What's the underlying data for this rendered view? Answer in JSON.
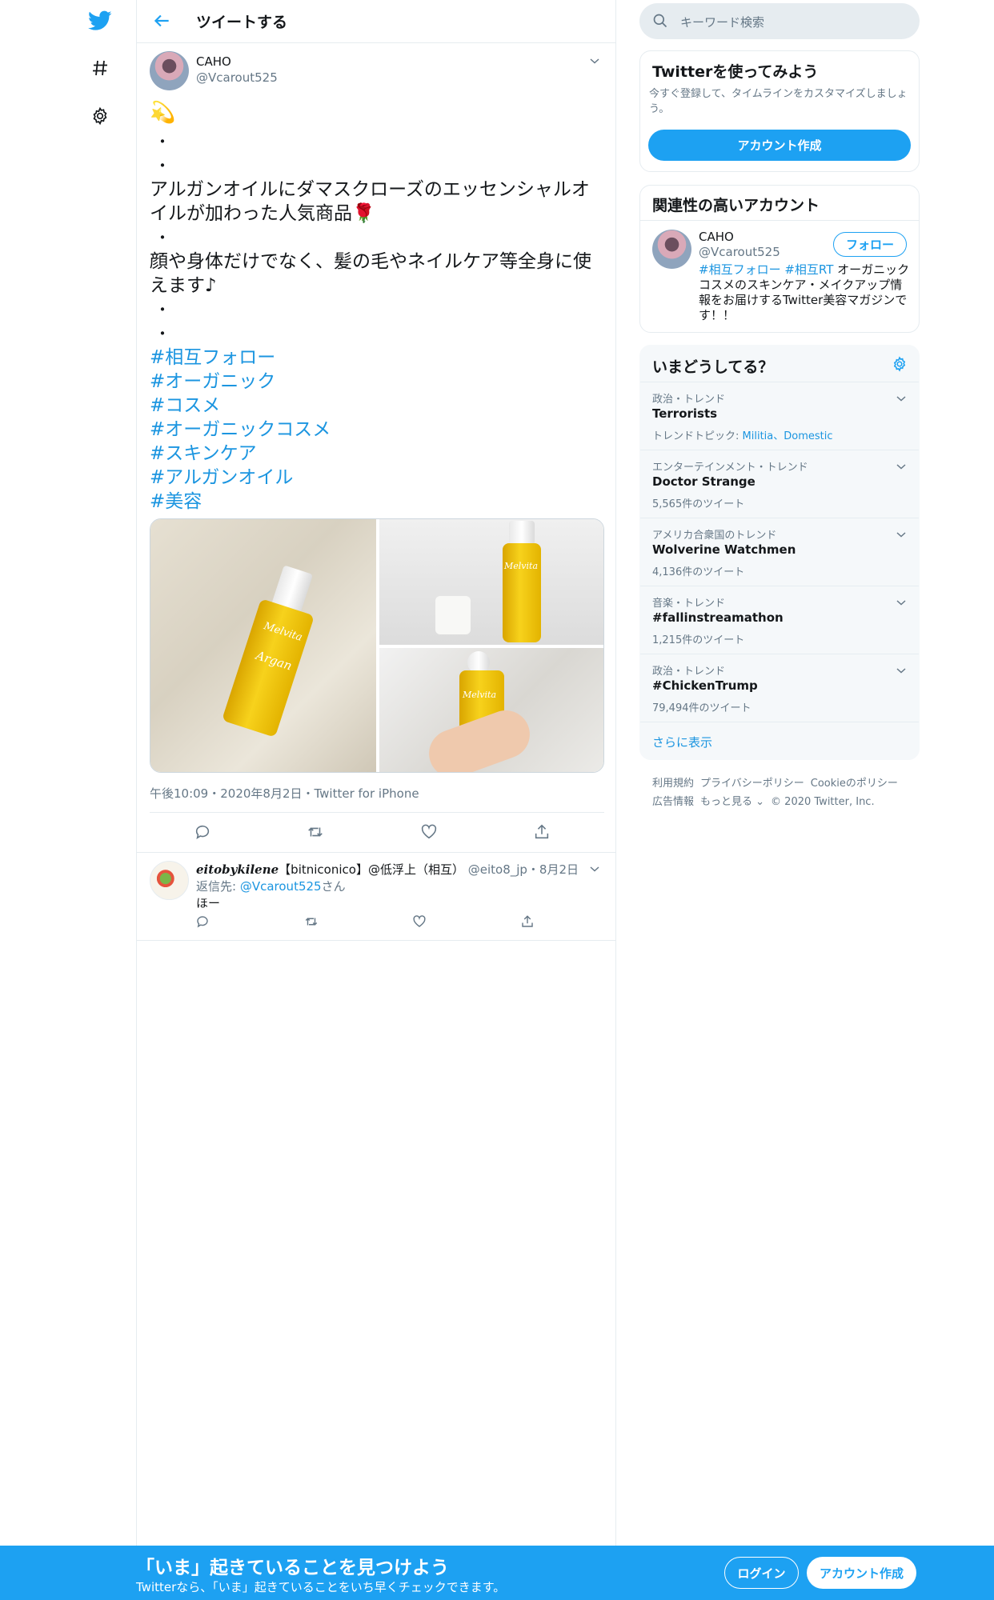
{
  "colors": {
    "accent": "#1da1f2",
    "link": "#1b95e0",
    "muted": "#657786",
    "text": "#14171a",
    "border": "#e6ecf0"
  },
  "nav": {
    "icons": [
      "twitter-bird-icon",
      "explore-hashtag-icon",
      "settings-gear-icon"
    ]
  },
  "header": {
    "title": "ツイートする"
  },
  "tweet": {
    "author_name": "CAHO",
    "author_handle": "@Vcarout525",
    "emoji": "💫",
    "lines": [
      "・",
      "・",
      "アルガンオイルにダマスクローズのエッセンシャルオイルが加わった人気商品🌹",
      "・",
      "顔や身体だけでなく、髪の毛やネイルケア等全身に使えます♪",
      "・",
      "・"
    ],
    "hashtags": [
      "#相互フォロー",
      "#オーガニック",
      "#コスメ",
      "#オーガニックコスメ",
      "#スキンケア",
      "#アルガンオイル",
      "#美容"
    ],
    "photo_brand_text": "Melvita",
    "photo_product_text": "Argan",
    "timestamp": "午後10:09・2020年8月2日・Twitter for iPhone"
  },
  "reply": {
    "name": "eitobykilene",
    "name_suffix": "【bitniconico】@低浮上（相互）",
    "handle": "@eito8_jp",
    "date": "・8月2日",
    "reply_to_label": "返信先:",
    "reply_to_handle": "@Vcarout525",
    "reply_to_suffix": "さん",
    "text": "ほー"
  },
  "search": {
    "placeholder": "キーワード検索"
  },
  "signup_card": {
    "title": "Twitterを使ってみよう",
    "description": "今すぐ登録して、タイムラインをカスタマイズしましょう。",
    "button": "アカウント作成"
  },
  "related": {
    "title": "関連性の高いアカウント",
    "name": "CAHO",
    "handle": "@Vcarout525",
    "follow_button": "フォロー",
    "bio_tags": "#相互フォロー #相互RT",
    "bio_text": " オーガニックコスメのスキンケア・メイクアップ情報をお届けするTwitter美容マガジンです！！"
  },
  "trends": {
    "title": "いまどうしてる？",
    "items": [
      {
        "meta": "政治・トレンド",
        "name": "Terrorists",
        "count": "",
        "topics_label": "トレンドトピック: ",
        "topics": "Militia、Domestic"
      },
      {
        "meta": "エンターテインメント・トレンド",
        "name": "Doctor Strange",
        "count": "5,565件のツイート"
      },
      {
        "meta": "アメリカ合衆国のトレンド",
        "name": "Wolverine Watchmen",
        "count": "4,136件のツイート"
      },
      {
        "meta": "音楽・トレンド",
        "name": "#fallinstreamathon",
        "count": "1,215件のツイート"
      },
      {
        "meta": "政治・トレンド",
        "name": "#ChickenTrump",
        "count": "79,494件のツイート"
      }
    ],
    "show_more": "さらに表示"
  },
  "footer": {
    "links": [
      "利用規約",
      "プライバシーポリシー",
      "Cookieのポリシー",
      "広告情報",
      "もっと見る ⌄",
      "© 2020 Twitter, Inc."
    ]
  },
  "bottom_bar": {
    "title": "「いま」起きていることを見つけよう",
    "subtitle": "Twitterなら、「いま」起きていることをいち早くチェックできます。",
    "login": "ログイン",
    "signup": "アカウント作成"
  }
}
